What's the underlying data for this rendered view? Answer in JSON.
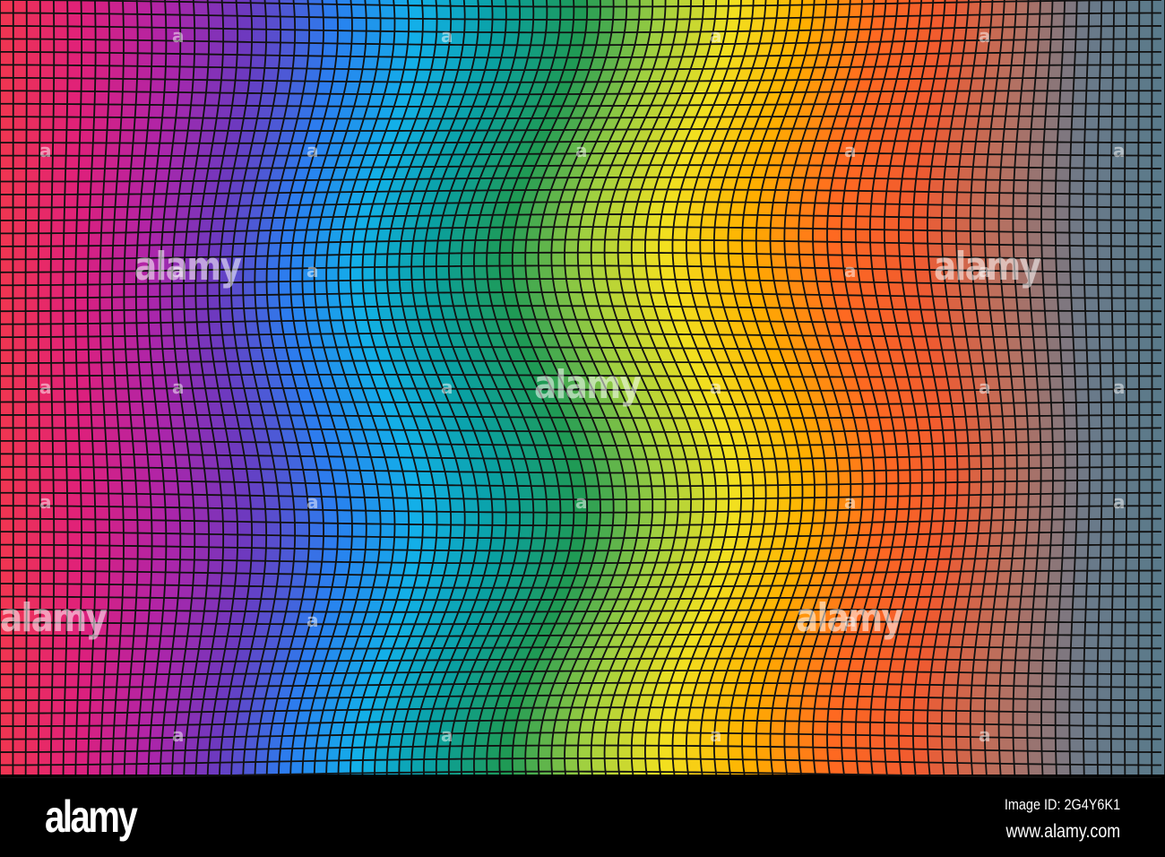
{
  "image": {
    "description_colors": [
      "#f0364f",
      "#e0207a",
      "#b024a8",
      "#6a3ac0",
      "#2a7ff0",
      "#12b0e8",
      "#0aa0a0",
      "#1f9a55",
      "#a0d040",
      "#f2e020",
      "#ffb000",
      "#ff6a20",
      "#f05a30",
      "#b87060",
      "#6a7a8a",
      "#587a8a"
    ],
    "grid_columns": 89,
    "grid_rows": 60
  },
  "watermark": {
    "text": "alamy",
    "mark": "a"
  },
  "footer": {
    "logo": "alamy",
    "image_id": "Image ID: 2G4Y6K1",
    "url": "www.alamy.com"
  }
}
